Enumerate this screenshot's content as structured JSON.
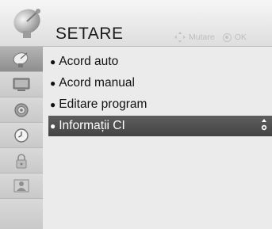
{
  "header": {
    "title": "SETARE",
    "hint_move": "Mutare",
    "hint_ok": "OK"
  },
  "sidebar": {
    "items": [
      {
        "icon": "satellite-dish-icon",
        "active": true
      },
      {
        "icon": "picture-icon",
        "active": false
      },
      {
        "icon": "audio-speaker-icon",
        "active": false
      },
      {
        "icon": "clock-icon",
        "active": false
      },
      {
        "icon": "lock-icon",
        "active": false
      },
      {
        "icon": "option-person-icon",
        "active": false
      }
    ]
  },
  "menu": {
    "bullet": "●",
    "items": [
      {
        "label": "Acord auto",
        "selected": false
      },
      {
        "label": "Acord manual",
        "selected": false
      },
      {
        "label": "Editare program",
        "selected": false
      },
      {
        "label": "Informații CI",
        "selected": true
      }
    ]
  },
  "colors": {
    "selected_bg": "#4f4f4f",
    "panel_bg": "#ebebeb",
    "sidebar_active": "#9a9a9a"
  }
}
